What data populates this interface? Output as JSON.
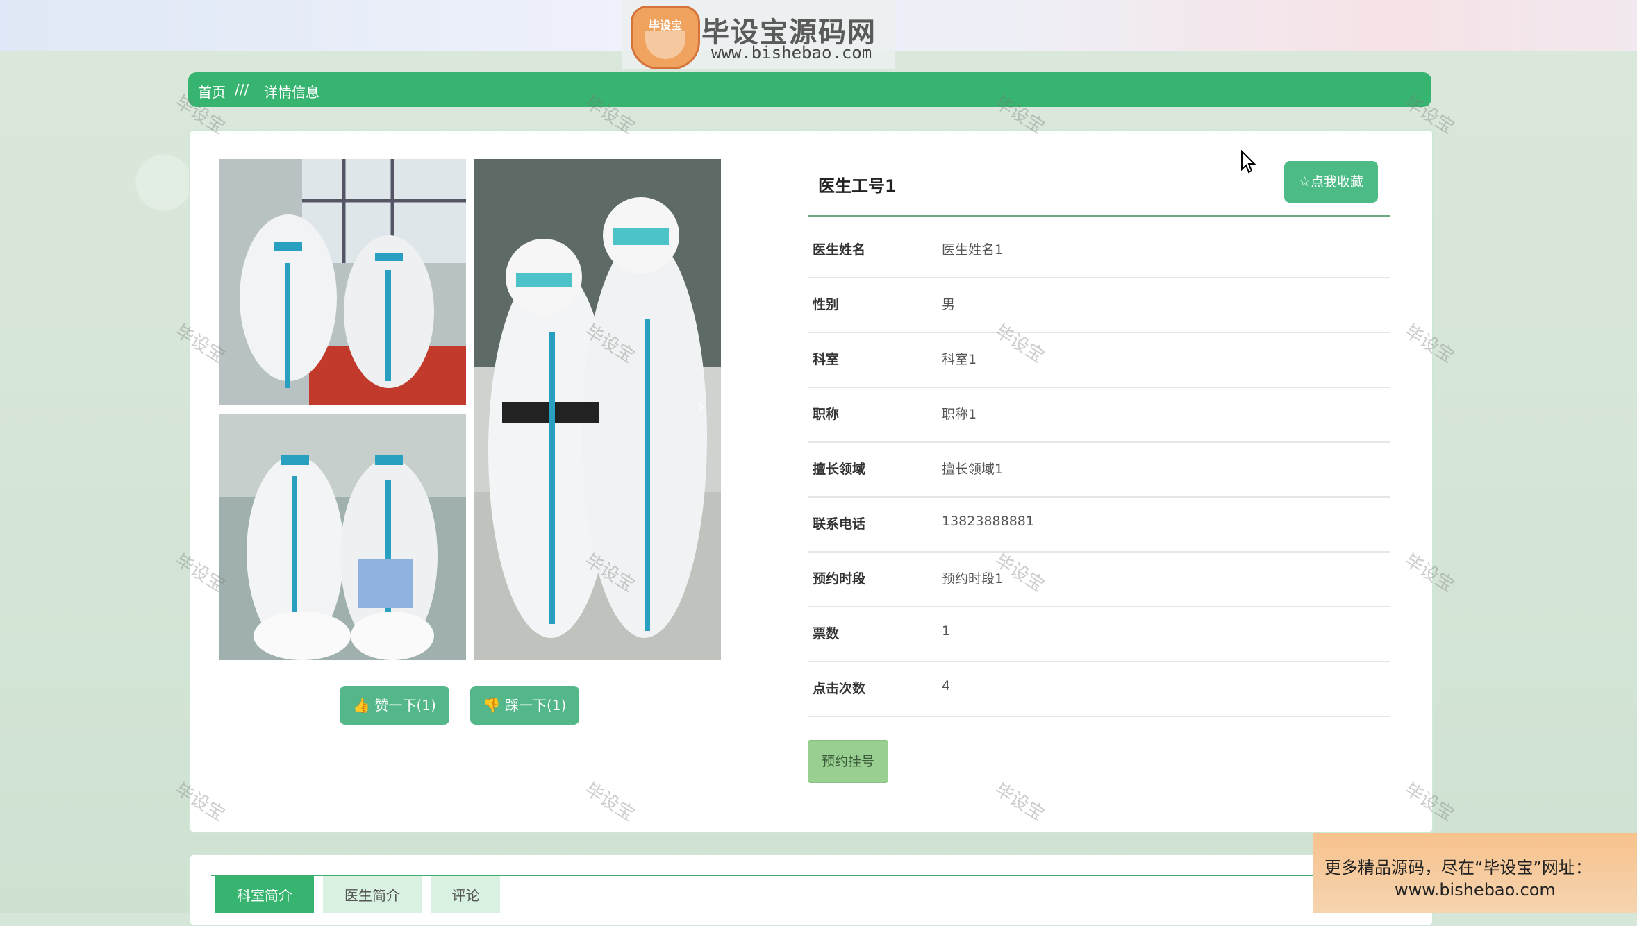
{
  "header": {
    "logo_badge_text": "毕设宝",
    "logo_title": "毕设宝源码网",
    "logo_url": "www.bishebao.com"
  },
  "breadcrumb": {
    "home": "首页",
    "separator": "///",
    "current": "详情信息"
  },
  "detail": {
    "title": "医生工号1",
    "favorite_label": "☆点我收藏",
    "fields": [
      {
        "label": "医生姓名",
        "value": "医生姓名1"
      },
      {
        "label": "性别",
        "value": "男"
      },
      {
        "label": "科室",
        "value": "科室1"
      },
      {
        "label": "职称",
        "value": "职称1"
      },
      {
        "label": "擅长领域",
        "value": "擅长领域1"
      },
      {
        "label": "联系电话",
        "value": "13823888881"
      },
      {
        "label": "预约时段",
        "value": "预约时段1"
      },
      {
        "label": "票数",
        "value": "1"
      },
      {
        "label": "点击次数",
        "value": "4"
      }
    ],
    "reserve_label": "预约挂号"
  },
  "actions": {
    "like_label": "赞一下(1)",
    "dislike_label": "踩一下(1)"
  },
  "tabs": [
    {
      "label": "科室简介",
      "active": true
    },
    {
      "label": "医生简介",
      "active": false
    },
    {
      "label": "评论",
      "active": false
    }
  ],
  "watermark": "毕设宝",
  "promo": {
    "line1": "更多精品源码，尽在“毕设宝”网址：",
    "line2": "www.bishebao.com"
  },
  "colors": {
    "primary": "#37b46f",
    "accent": "#4dbb86",
    "reserve": "#99cf90"
  }
}
